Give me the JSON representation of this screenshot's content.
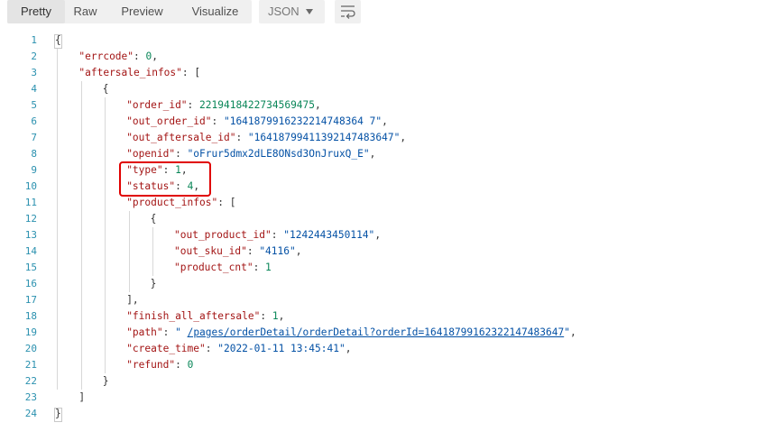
{
  "toolbar": {
    "tabs": [
      {
        "label": "Pretty",
        "active": true
      },
      {
        "label": "Raw",
        "active": false
      },
      {
        "label": "Preview",
        "active": false
      },
      {
        "label": "Visualize",
        "active": false
      }
    ],
    "format_select": {
      "value": "JSON"
    },
    "wrap_icon": "wrap-lines-icon"
  },
  "editor": {
    "lines": [
      {
        "n": "1",
        "tokens": [
          {
            "t": "{",
            "c": "p"
          }
        ]
      },
      {
        "n": "2",
        "tokens": [
          {
            "t": "\"errcode\"",
            "c": "key"
          },
          {
            "t": ": ",
            "c": "p"
          },
          {
            "t": "0",
            "c": "num"
          },
          {
            "t": ",",
            "c": "p"
          }
        ]
      },
      {
        "n": "3",
        "tokens": [
          {
            "t": "\"aftersale_infos\"",
            "c": "key"
          },
          {
            "t": ": [",
            "c": "p"
          }
        ]
      },
      {
        "n": "4",
        "tokens": [
          {
            "t": "{",
            "c": "p"
          }
        ]
      },
      {
        "n": "5",
        "tokens": [
          {
            "t": "\"order_id\"",
            "c": "key"
          },
          {
            "t": ": ",
            "c": "p"
          },
          {
            "t": "2219418422734569475",
            "c": "num"
          },
          {
            "t": ",",
            "c": "p"
          }
        ]
      },
      {
        "n": "6",
        "tokens": [
          {
            "t": "\"out_order_id\"",
            "c": "key"
          },
          {
            "t": ": ",
            "c": "p"
          },
          {
            "t": "\"1641879916232214748364 7\"",
            "c": "str"
          },
          {
            "t": ",",
            "c": "p"
          }
        ]
      },
      {
        "n": "7",
        "tokens": [
          {
            "t": "\"out_aftersale_id\"",
            "c": "key"
          },
          {
            "t": ": ",
            "c": "p"
          },
          {
            "t": "\"16418799411392147483647\"",
            "c": "str"
          },
          {
            "t": ",",
            "c": "p"
          }
        ]
      },
      {
        "n": "8",
        "tokens": [
          {
            "t": "\"openid\"",
            "c": "key"
          },
          {
            "t": ": ",
            "c": "p"
          },
          {
            "t": "\"oFrur5dmx2dLE8ONsd3OnJruxQ_E\"",
            "c": "str"
          },
          {
            "t": ",",
            "c": "p"
          }
        ]
      },
      {
        "n": "9",
        "tokens": [
          {
            "t": "\"type\"",
            "c": "key"
          },
          {
            "t": ": ",
            "c": "p"
          },
          {
            "t": "1",
            "c": "num"
          },
          {
            "t": ",",
            "c": "p"
          }
        ]
      },
      {
        "n": "10",
        "tokens": [
          {
            "t": "\"status\"",
            "c": "key"
          },
          {
            "t": ": ",
            "c": "p"
          },
          {
            "t": "4",
            "c": "num"
          },
          {
            "t": ",",
            "c": "p"
          }
        ]
      },
      {
        "n": "11",
        "tokens": [
          {
            "t": "\"product_infos\"",
            "c": "key"
          },
          {
            "t": ": [",
            "c": "p"
          }
        ]
      },
      {
        "n": "12",
        "tokens": [
          {
            "t": "{",
            "c": "p"
          }
        ]
      },
      {
        "n": "13",
        "tokens": [
          {
            "t": "\"out_product_id\"",
            "c": "key"
          },
          {
            "t": ": ",
            "c": "p"
          },
          {
            "t": "\"1242443450114\"",
            "c": "str"
          },
          {
            "t": ",",
            "c": "p"
          }
        ]
      },
      {
        "n": "14",
        "tokens": [
          {
            "t": "\"out_sku_id\"",
            "c": "key"
          },
          {
            "t": ": ",
            "c": "p"
          },
          {
            "t": "\"4116\"",
            "c": "str"
          },
          {
            "t": ",",
            "c": "p"
          }
        ]
      },
      {
        "n": "15",
        "tokens": [
          {
            "t": "\"product_cnt\"",
            "c": "key"
          },
          {
            "t": ": ",
            "c": "p"
          },
          {
            "t": "1",
            "c": "num"
          }
        ]
      },
      {
        "n": "16",
        "tokens": [
          {
            "t": "}",
            "c": "p"
          }
        ]
      },
      {
        "n": "17",
        "tokens": [
          {
            "t": "],",
            "c": "p"
          }
        ]
      },
      {
        "n": "18",
        "tokens": [
          {
            "t": "\"finish_all_aftersale\"",
            "c": "key"
          },
          {
            "t": ": ",
            "c": "p"
          },
          {
            "t": "1",
            "c": "num"
          },
          {
            "t": ",",
            "c": "p"
          }
        ]
      },
      {
        "n": "19",
        "tokens": [
          {
            "t": "\"path\"",
            "c": "key"
          },
          {
            "t": ": ",
            "c": "p"
          },
          {
            "t": "\" ",
            "c": "str"
          },
          {
            "t": "/pages/orderDetail/orderDetail?orderId=16418799162322147483647",
            "c": "link"
          },
          {
            "t": "\"",
            "c": "str"
          },
          {
            "t": ",",
            "c": "p"
          }
        ]
      },
      {
        "n": "20",
        "tokens": [
          {
            "t": "\"create_time\"",
            "c": "key"
          },
          {
            "t": ": ",
            "c": "p"
          },
          {
            "t": "\"2022-01-11 13:45:41\"",
            "c": "str"
          },
          {
            "t": ",",
            "c": "p"
          }
        ]
      },
      {
        "n": "21",
        "tokens": [
          {
            "t": "\"refund\"",
            "c": "key"
          },
          {
            "t": ": ",
            "c": "p"
          },
          {
            "t": "0",
            "c": "num"
          }
        ]
      },
      {
        "n": "22",
        "tokens": [
          {
            "t": "}",
            "c": "p"
          }
        ]
      },
      {
        "n": "23",
        "tokens": [
          {
            "t": "]",
            "c": "p"
          }
        ]
      },
      {
        "n": "24",
        "tokens": [
          {
            "t": "}",
            "c": "p"
          }
        ]
      }
    ]
  }
}
